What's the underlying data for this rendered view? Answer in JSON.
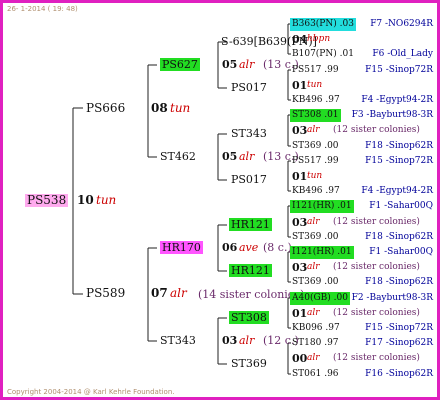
{
  "header": {
    "timestamp": "26- 1-2014 ( 19: 48)"
  },
  "footer": {
    "copyright": "Copyright 2004-2014 @ Karl Kehrle Foundation."
  },
  "colors": {
    "frame": "#e020c0",
    "green_highlight": "#22dd22",
    "cyan_highlight": "#22dddd",
    "magenta_highlight": "#ff55ff",
    "pink_highlight": "#ffaaee",
    "breed_value": "#cc0000",
    "pedigree_code": "#000099"
  },
  "subject": {
    "name": "PS538",
    "year": "10",
    "breeder": "tun"
  },
  "gen1": {
    "sire": {
      "name": "PS666",
      "year": "08",
      "breeder": "tun"
    },
    "dam": {
      "name": "PS589",
      "year": "07",
      "breeder": "alr",
      "note": "(14 sister colonies)"
    }
  },
  "gen2": {
    "a": {
      "name": "PS627",
      "year": "05",
      "breeder": "alr",
      "note": "(13 c.)"
    },
    "b": {
      "name": "ST462",
      "year": "05",
      "breeder": "alr",
      "note": "(13 c.)"
    },
    "c": {
      "name": "HR170",
      "year": "06",
      "breeder": "ave",
      "note": "(8 c.)"
    },
    "d": {
      "name": "ST343",
      "year": "03",
      "breeder": "alr",
      "note": "(12 c.)"
    }
  },
  "gen3": {
    "a1": "S-639[B639(PN)]",
    "a2": "PS017",
    "b1": "ST343",
    "b2": "PS017",
    "c1": "HR121",
    "c2": "HR121",
    "d1": "ST308",
    "d2": "ST369"
  },
  "gen4": [
    {
      "id": "B363(PN) .03",
      "pedigree": "F7 -NO6294R",
      "hl": "cyan"
    },
    {
      "year": "04",
      "breeder": "hbpn",
      "note": ""
    },
    {
      "id": "B107(PN) .01",
      "pedigree": "F6 -Old_Lady"
    },
    {
      "id": "PS517 .99",
      "pedigree": "F15 -Sinop72R"
    },
    {
      "year": "01",
      "breeder": "tun",
      "note": ""
    },
    {
      "id": "KB496 .97",
      "pedigree": "F4 -Egypt94-2R"
    },
    {
      "id": "ST308 .01",
      "pedigree": "F3 -Bayburt98-3R",
      "hl": "green"
    },
    {
      "year": "03",
      "breeder": "alr",
      "note": "(12 sister colonies)"
    },
    {
      "id": "ST369 .00",
      "pedigree": "F18 -Sinop62R"
    },
    {
      "id": "PS517 .99",
      "pedigree": "F15 -Sinop72R"
    },
    {
      "year": "01",
      "breeder": "tun",
      "note": ""
    },
    {
      "id": "KB496 .97",
      "pedigree": "F4 -Egypt94-2R"
    },
    {
      "id": "I121(HR) .01",
      "pedigree": "F1 -Sahar00Q",
      "hl": "green"
    },
    {
      "year": "03",
      "breeder": "alr",
      "note": "(12 sister colonies)"
    },
    {
      "id": "ST369 .00",
      "pedigree": "F18 -Sinop62R"
    },
    {
      "id": "I121(HR) .01",
      "pedigree": "F1 -Sahar00Q",
      "hl": "green"
    },
    {
      "year": "03",
      "breeder": "alr",
      "note": "(12 sister colonies)"
    },
    {
      "id": "ST369 .00",
      "pedigree": "F18 -Sinop62R"
    },
    {
      "id": "A40(GB) .00",
      "pedigree": "F2 -Bayburt98-3R",
      "hl": "green"
    },
    {
      "year": "01",
      "breeder": "alr",
      "note": "(12 sister colonies)"
    },
    {
      "id": "KB096 .97",
      "pedigree": "F15 -Sinop72R"
    },
    {
      "id": "ST180 .97",
      "pedigree": "F17 -Sinop62R"
    },
    {
      "year": "00",
      "breeder": "alr",
      "note": "(12 sister colonies)"
    },
    {
      "id": "ST061 .96",
      "pedigree": "F16 -Sinop62R"
    }
  ]
}
